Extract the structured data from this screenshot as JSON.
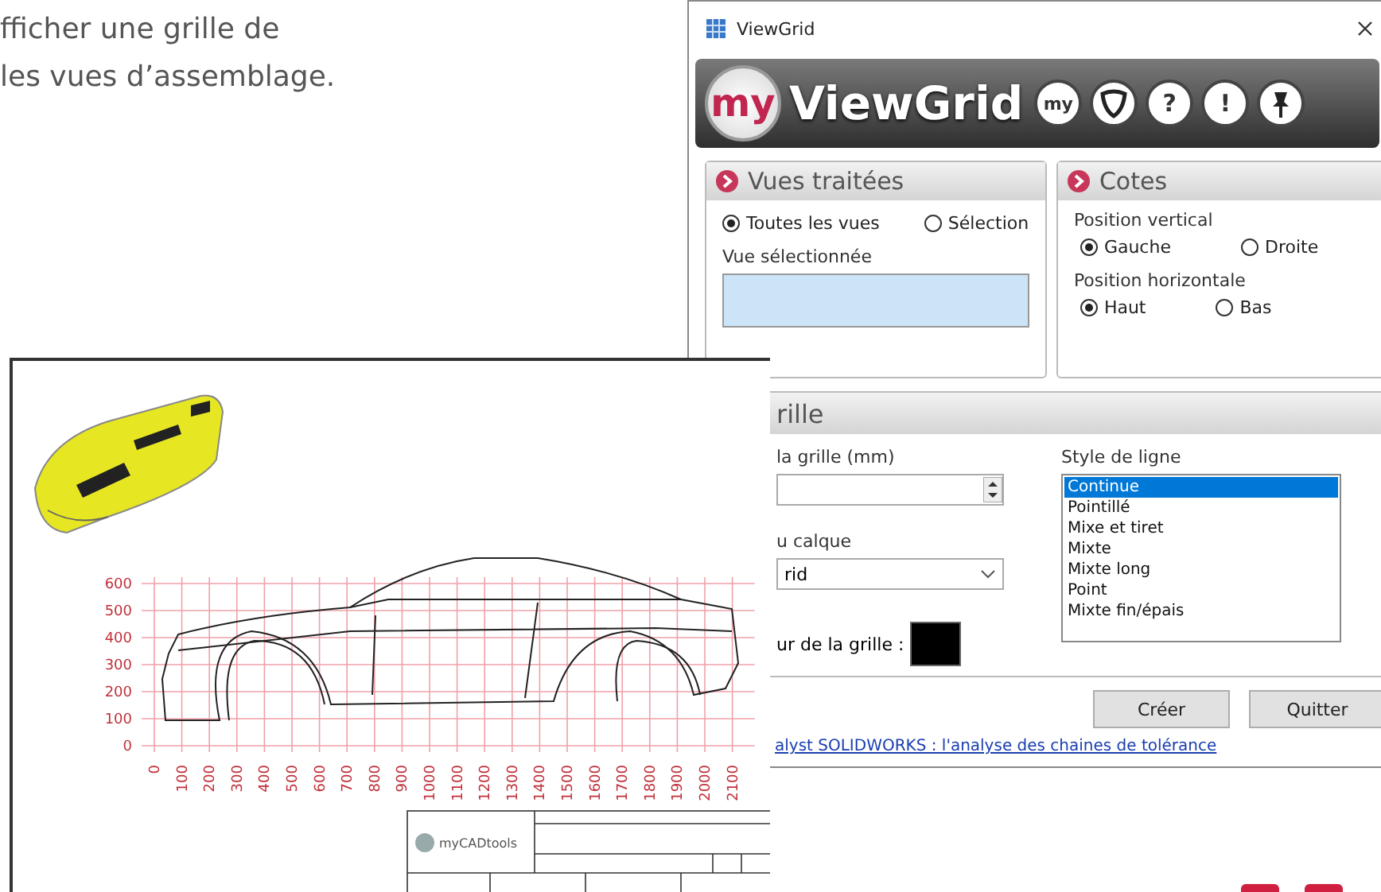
{
  "intro": [
    "fficher une grille de",
    "les vues d’assemblage."
  ],
  "window": {
    "title": "ViewGrid"
  },
  "banner": {
    "logo": "my",
    "title": "ViewGrid",
    "tools": [
      {
        "kind": "text",
        "label": "my"
      },
      {
        "kind": "shield"
      },
      {
        "kind": "text",
        "label": "?"
      },
      {
        "kind": "text",
        "label": "!"
      },
      {
        "kind": "pin"
      }
    ]
  },
  "processed_views": {
    "title": "Vues traitées",
    "options": [
      {
        "label": "Toutes les vues",
        "selected": true
      },
      {
        "label": "Sélection",
        "selected": false
      }
    ],
    "field_label": "Vue sélectionnée"
  },
  "dimensions": {
    "title": "Cotes",
    "groups": [
      {
        "label": "Position vertical",
        "options": [
          {
            "label": "Gauche",
            "selected": true
          },
          {
            "label": "Droite",
            "selected": false
          }
        ]
      },
      {
        "label": "Position horizontale",
        "options": [
          {
            "label": "Haut",
            "selected": true
          },
          {
            "label": "Bas",
            "selected": false
          }
        ]
      }
    ]
  },
  "grid": {
    "title": "rille",
    "size_label": "la grille (mm)",
    "layer_label": "u calque",
    "layer_value": "rid",
    "color_label": "ur de la grille :",
    "color": "#000000",
    "line_style_label": "Style de ligne",
    "line_styles": [
      {
        "label": "Continue",
        "selected": true
      },
      {
        "label": "Pointillé",
        "selected": false
      },
      {
        "label": "Mixe et tiret",
        "selected": false
      },
      {
        "label": "Mixte",
        "selected": false
      },
      {
        "label": "Mixte long",
        "selected": false
      },
      {
        "label": "Point",
        "selected": false
      },
      {
        "label": "Mixte fin/épais",
        "selected": false
      }
    ]
  },
  "buttons": [
    "Créer",
    "Quitter"
  ],
  "link": "alyst SOLIDWORKS : l'analyse des chaines de tolérance",
  "sheet": {
    "y_labels": [
      "600",
      "500",
      "400",
      "300",
      "200",
      "100",
      "0"
    ],
    "x_labels": [
      "0",
      "100",
      "200",
      "300",
      "400",
      "500",
      "600",
      "700",
      "800",
      "900",
      "1000",
      "1100",
      "1200",
      "1300",
      "1400",
      "1500",
      "1600",
      "1700",
      "1800",
      "1900",
      "2000",
      "2100"
    ],
    "brand": "myCADtools"
  }
}
